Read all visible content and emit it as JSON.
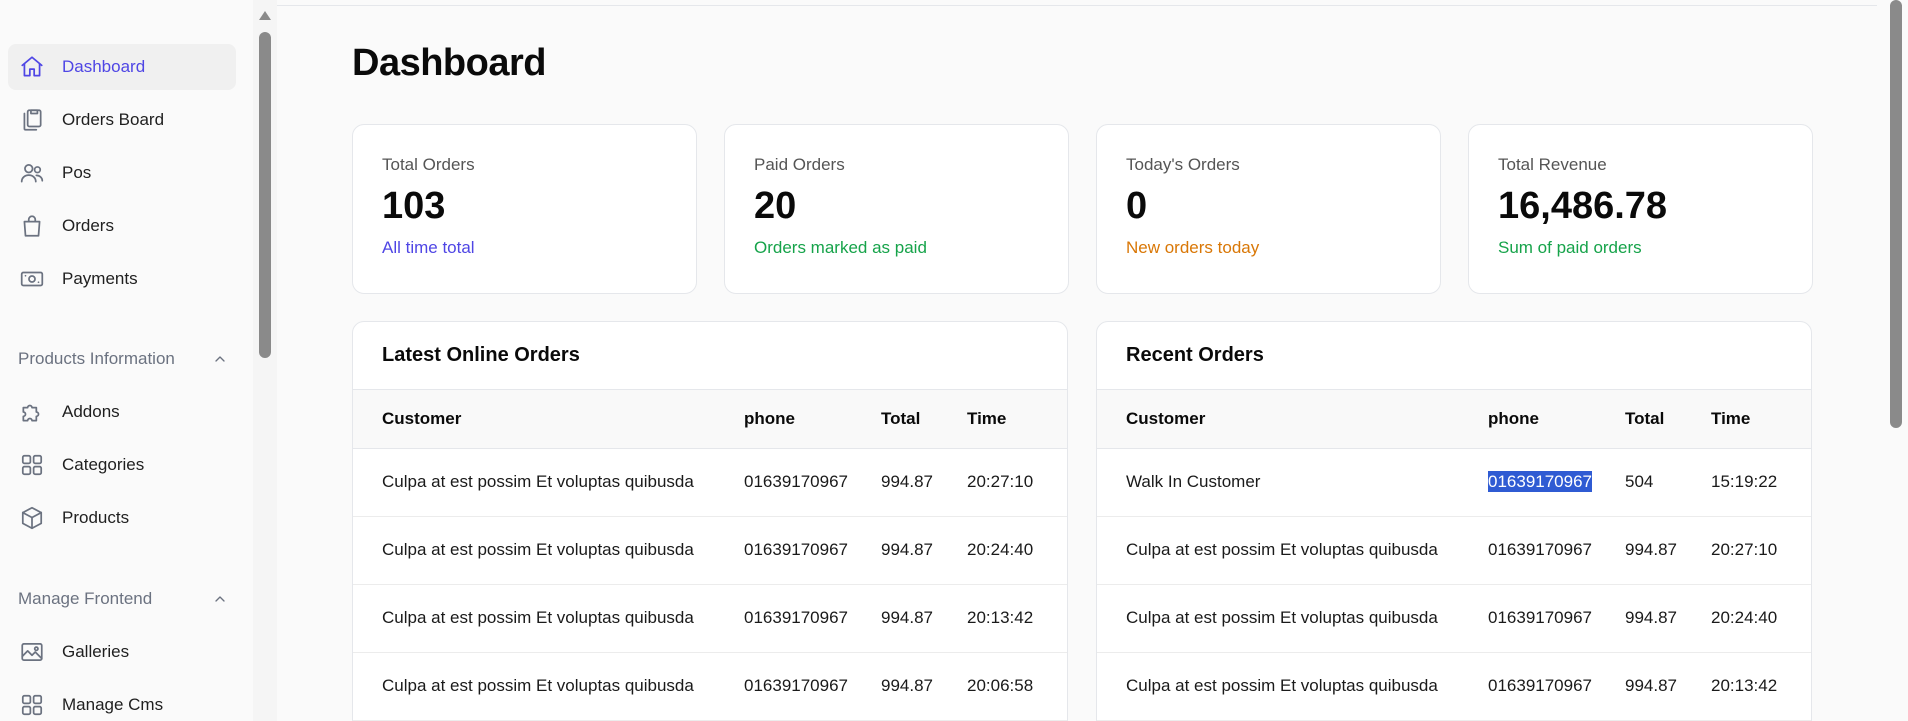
{
  "sidebar": {
    "items": [
      {
        "label": "Dashboard",
        "icon": "home-icon",
        "active": true
      },
      {
        "label": "Orders Board",
        "icon": "clipboard-icon"
      },
      {
        "label": "Pos",
        "icon": "users-icon"
      },
      {
        "label": "Orders",
        "icon": "shopping-bag-icon"
      },
      {
        "label": "Payments",
        "icon": "banknote-icon"
      }
    ],
    "sections": [
      {
        "label": "Products Information",
        "items": [
          {
            "label": "Addons",
            "icon": "puzzle-icon"
          },
          {
            "label": "Categories",
            "icon": "grid-icon"
          },
          {
            "label": "Products",
            "icon": "cube-icon"
          }
        ]
      },
      {
        "label": "Manage Frontend",
        "items": [
          {
            "label": "Galleries",
            "icon": "image-icon"
          },
          {
            "label": "Manage Cms",
            "icon": "grid-icon"
          }
        ]
      }
    ]
  },
  "page": {
    "title": "Dashboard"
  },
  "stats": [
    {
      "label": "Total Orders",
      "value": "103",
      "note": "All time total",
      "note_color": "#4f46e5"
    },
    {
      "label": "Paid Orders",
      "value": "20",
      "note": "Orders marked as paid",
      "note_color": "#16a34a"
    },
    {
      "label": "Today's Orders",
      "value": "0",
      "note": "New orders today",
      "note_color": "#d97706"
    },
    {
      "label": "Total Revenue",
      "value": "16,486.78",
      "note": "Sum of paid orders",
      "note_color": "#16a34a"
    }
  ],
  "latest_online_orders": {
    "title": "Latest Online Orders",
    "columns": [
      "Customer",
      "phone",
      "Total",
      "Time"
    ],
    "rows": [
      [
        "Culpa at est possim Et voluptas quibusda",
        "01639170967",
        "994.87",
        "20:27:10"
      ],
      [
        "Culpa at est possim Et voluptas quibusda",
        "01639170967",
        "994.87",
        "20:24:40"
      ],
      [
        "Culpa at est possim Et voluptas quibusda",
        "01639170967",
        "994.87",
        "20:13:42"
      ],
      [
        "Culpa at est possim Et voluptas quibusda",
        "01639170967",
        "994.87",
        "20:06:58"
      ]
    ]
  },
  "recent_orders": {
    "title": "Recent Orders",
    "columns": [
      "Customer",
      "phone",
      "Total",
      "Time"
    ],
    "rows": [
      [
        "Walk In Customer",
        "01639170967",
        "504",
        "15:19:22"
      ],
      [
        "Culpa at est possim Et voluptas quibusda",
        "01639170967",
        "994.87",
        "20:27:10"
      ],
      [
        "Culpa at est possim Et voluptas quibusda",
        "01639170967",
        "994.87",
        "20:24:40"
      ],
      [
        "Culpa at est possim Et voluptas quibusda",
        "01639170967",
        "994.87",
        "20:13:42"
      ]
    ]
  },
  "colors": {
    "accent": "#4f46e5",
    "selection": "#2f5bd3"
  }
}
